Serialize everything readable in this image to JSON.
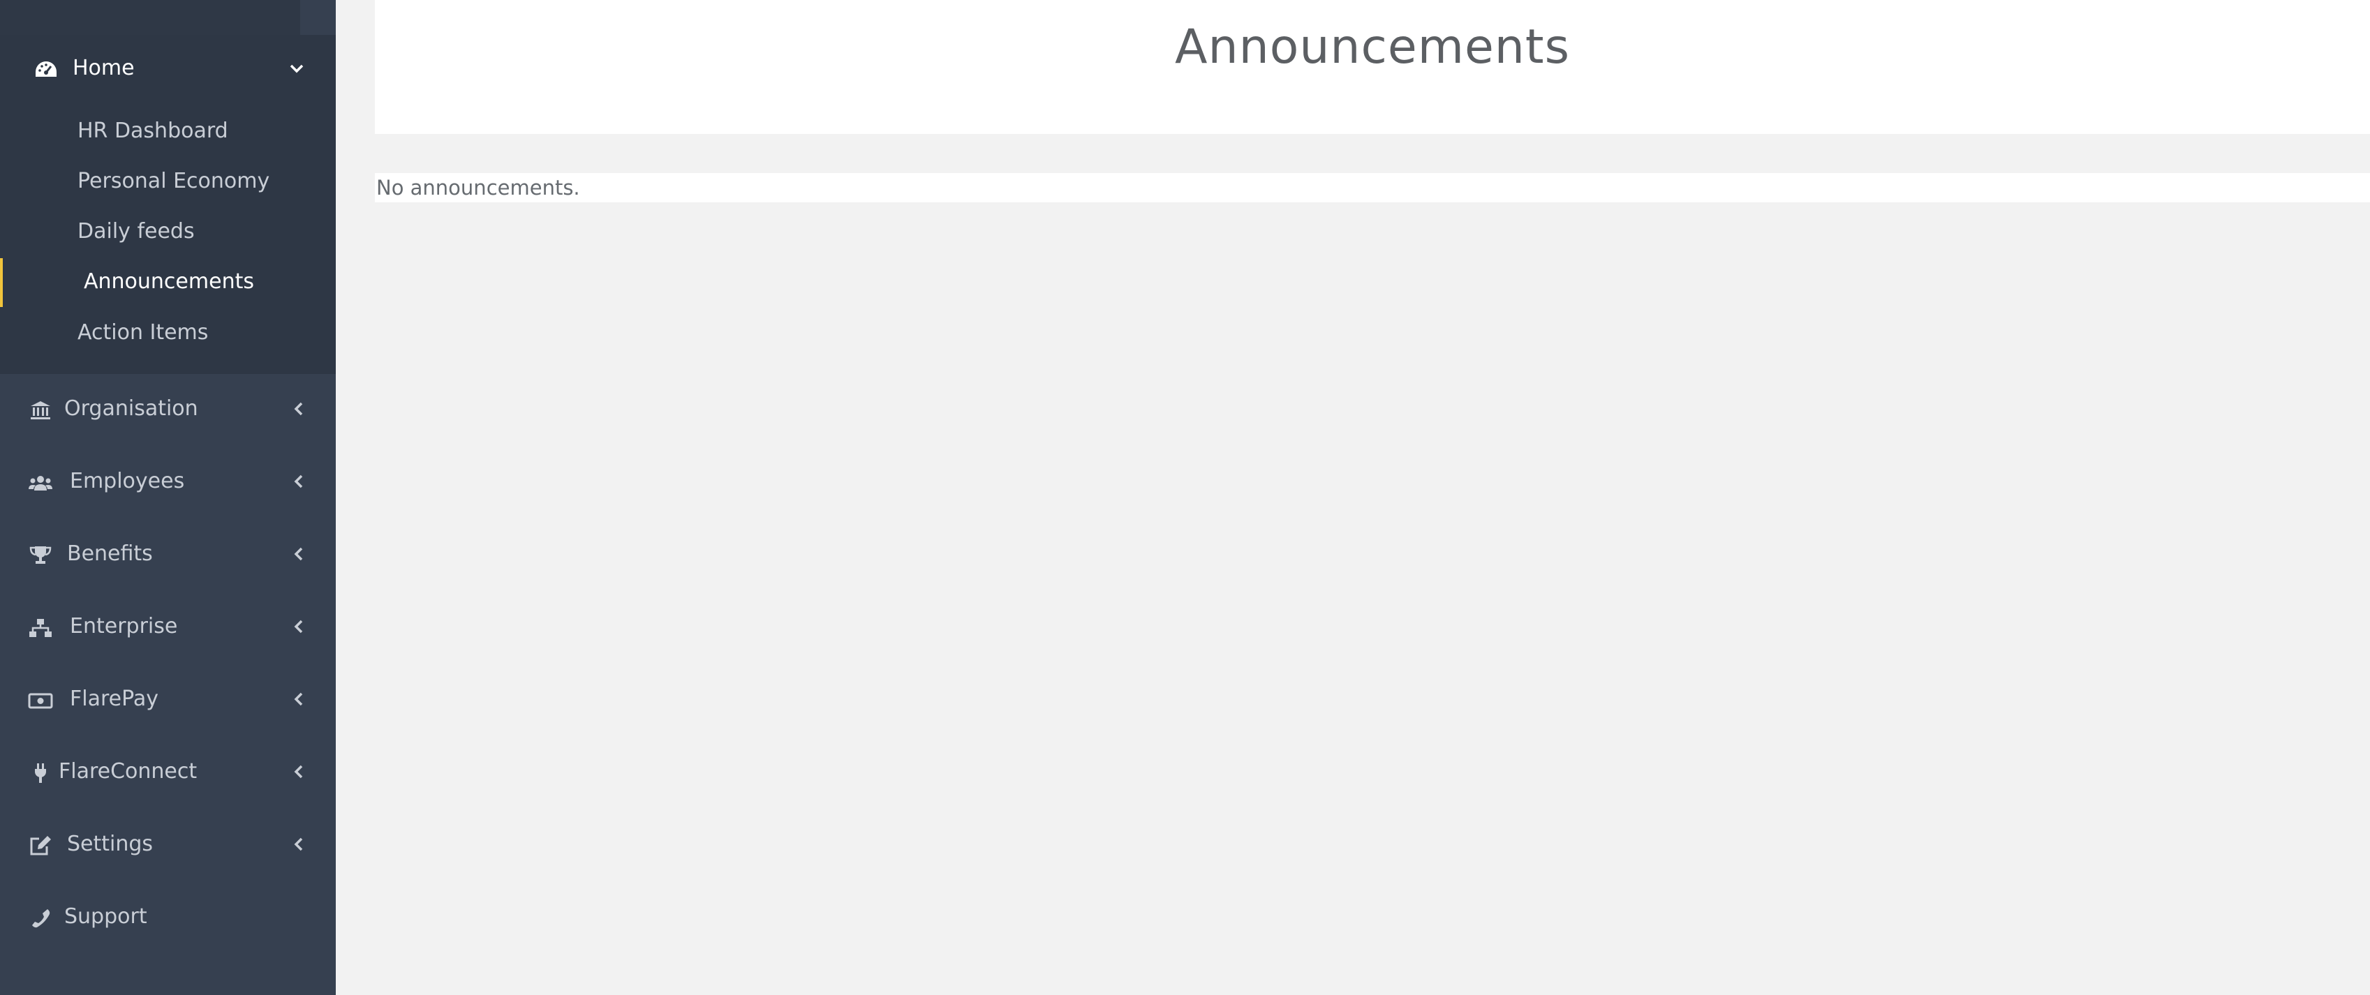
{
  "sidebar": {
    "home": {
      "label": "Home",
      "icon": "dashboard-gauge-icon",
      "expanded": true
    },
    "submenu": [
      {
        "label": "HR Dashboard",
        "active": false
      },
      {
        "label": "Personal Economy",
        "active": false
      },
      {
        "label": "Daily feeds",
        "active": false
      },
      {
        "label": "Announcements",
        "active": true
      },
      {
        "label": "Action Items",
        "active": false
      }
    ],
    "items": [
      {
        "label": "Organisation",
        "icon": "bank-building-icon",
        "has_children": true
      },
      {
        "label": "Employees",
        "icon": "users-group-icon",
        "has_children": true
      },
      {
        "label": "Benefits",
        "icon": "trophy-icon",
        "has_children": true
      },
      {
        "label": "Enterprise",
        "icon": "sitemap-icon",
        "has_children": true
      },
      {
        "label": "FlarePay",
        "icon": "money-bill-icon",
        "has_children": true
      },
      {
        "label": "FlareConnect",
        "icon": "plug-icon",
        "has_children": true
      },
      {
        "label": "Settings",
        "icon": "edit-square-icon",
        "has_children": true
      },
      {
        "label": "Support",
        "icon": "phone-icon",
        "has_children": false
      }
    ],
    "colors": {
      "background": "#364050",
      "submenu_background": "#2e3745",
      "active_accent": "#f0c43c",
      "text": "#c9ced6"
    }
  },
  "main": {
    "title": "Announcements",
    "empty_message": "No announcements."
  }
}
